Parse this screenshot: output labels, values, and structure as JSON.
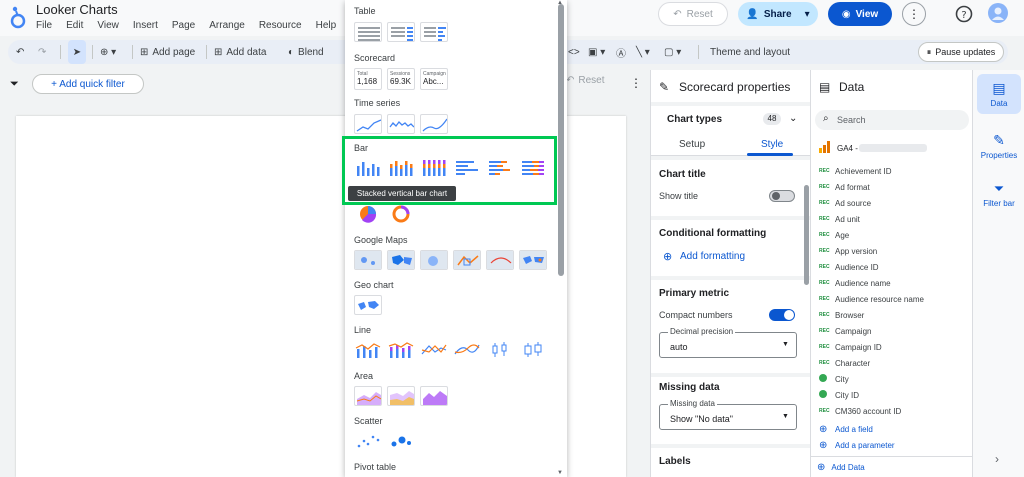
{
  "app": {
    "title": "Looker Charts"
  },
  "menu": [
    "File",
    "Edit",
    "View",
    "Insert",
    "Page",
    "Arrange",
    "Resource",
    "Help"
  ],
  "header": {
    "reset": "Reset",
    "share": "Share",
    "view": "View"
  },
  "toolbar": {
    "add_page": "Add page",
    "add_data": "Add data",
    "blend": "Blend",
    "theme_layout": "Theme and layout",
    "pause": "Pause updates"
  },
  "filterbar": {
    "quick_filter": "+ Add quick filter",
    "reset": "Reset"
  },
  "picker": {
    "sections": {
      "table": "Table",
      "scorecard": "Scorecard",
      "time_series": "Time series",
      "bar": "Bar",
      "google_maps": "Google Maps",
      "geo_chart": "Geo chart",
      "line": "Line",
      "area": "Area",
      "scatter": "Scatter",
      "pivot_table": "Pivot table"
    },
    "scorecards": [
      {
        "label": "Total",
        "value": "1,168"
      },
      {
        "label": "Sessions",
        "value": "69.3K"
      },
      {
        "label": "Campaign",
        "value": "Abc..."
      }
    ],
    "tooltip": "Stacked vertical bar chart"
  },
  "properties": {
    "title": "Scorecard properties",
    "chart_types": "Chart types",
    "chart_types_count": "48",
    "tabs": {
      "setup": "Setup",
      "style": "Style"
    },
    "chart_title": "Chart title",
    "show_title": "Show title",
    "conditional_formatting": "Conditional formatting",
    "add_formatting": "Add formatting",
    "primary_metric": "Primary metric",
    "compact_numbers": "Compact numbers",
    "decimal_precision_label": "Decimal precision",
    "decimal_precision_value": "auto",
    "missing_data": "Missing data",
    "missing_data_label": "Missing data",
    "missing_data_value": "Show \"No data\"",
    "labels": "Labels"
  },
  "data": {
    "title": "Data",
    "search_placeholder": "Search",
    "source": "GA4 -",
    "fields": [
      "Achievement ID",
      "Ad format",
      "Ad source",
      "Ad unit",
      "Age",
      "App version",
      "Audience ID",
      "Audience name",
      "Audience resource name",
      "Browser",
      "Campaign",
      "Campaign ID",
      "Character",
      "City",
      "City ID",
      "CM360 account ID"
    ],
    "add_field": "Add a field",
    "add_parameter": "Add a parameter",
    "add_data": "Add Data"
  },
  "rail": {
    "data": "Data",
    "properties": "Properties",
    "filter_bar": "Filter bar"
  },
  "colors": {
    "accent": "#0b57d0",
    "highlight": "#00c853",
    "chip_blue": "#c2e7ff"
  }
}
